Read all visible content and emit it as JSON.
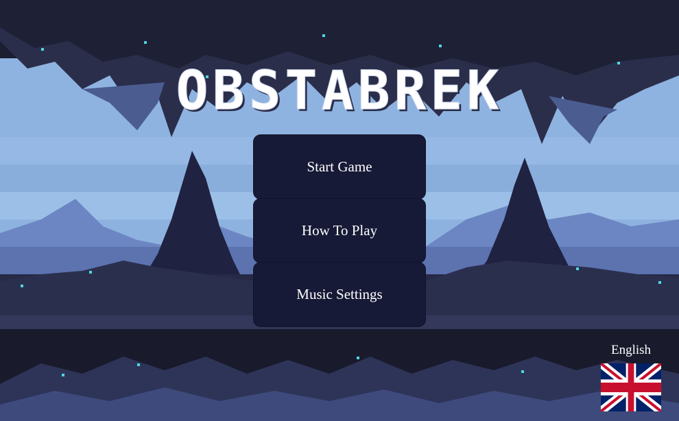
{
  "game": {
    "title": "OBSTABREK"
  },
  "menu": {
    "items": [
      {
        "label": "Start Game"
      },
      {
        "label": "How To Play"
      },
      {
        "label": "Music Settings"
      }
    ]
  },
  "language": {
    "label": "English",
    "flag": "uk-flag-icon"
  },
  "colors": {
    "button_bg": "#171a36",
    "sky_light": "#8fb3e0",
    "cave_dark": "#1a1c2e",
    "crystal": "#4fd6e0"
  }
}
